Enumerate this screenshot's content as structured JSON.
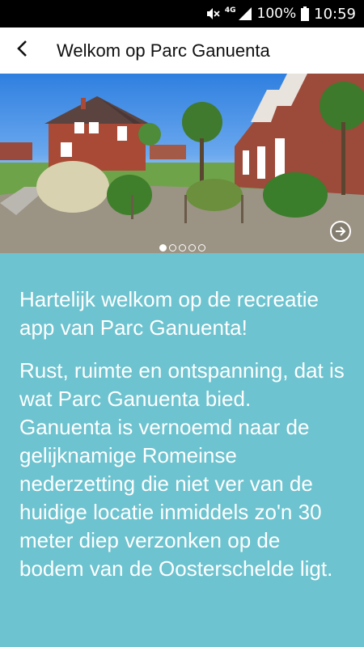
{
  "status_bar": {
    "network": "4G",
    "battery": "100%",
    "time": "10:59"
  },
  "app_bar": {
    "title": "Welkom op Parc Ganuenta"
  },
  "hero": {
    "slide_count": 5,
    "active_slide": 1
  },
  "content": {
    "welcome": "Hartelijk welkom op de recreatie app van Parc Ganuenta!",
    "description": "Rust, ruimte en ontspanning, dat is wat Parc Ganuenta bied. Ganuenta is vernoemd naar de gelijknamige Romeinse nederzetting die niet ver van de huidige locatie inmiddels zo'n 30 meter diep verzonken op de bodem van de Oosterschelde ligt."
  },
  "colors": {
    "content_background": "#6dc3cf",
    "app_bar": "#ffffff",
    "status_bar": "#000000"
  },
  "icons": [
    "mute-icon",
    "signal-icon",
    "battery-icon",
    "back-arrow-icon",
    "next-arrow-icon"
  ]
}
